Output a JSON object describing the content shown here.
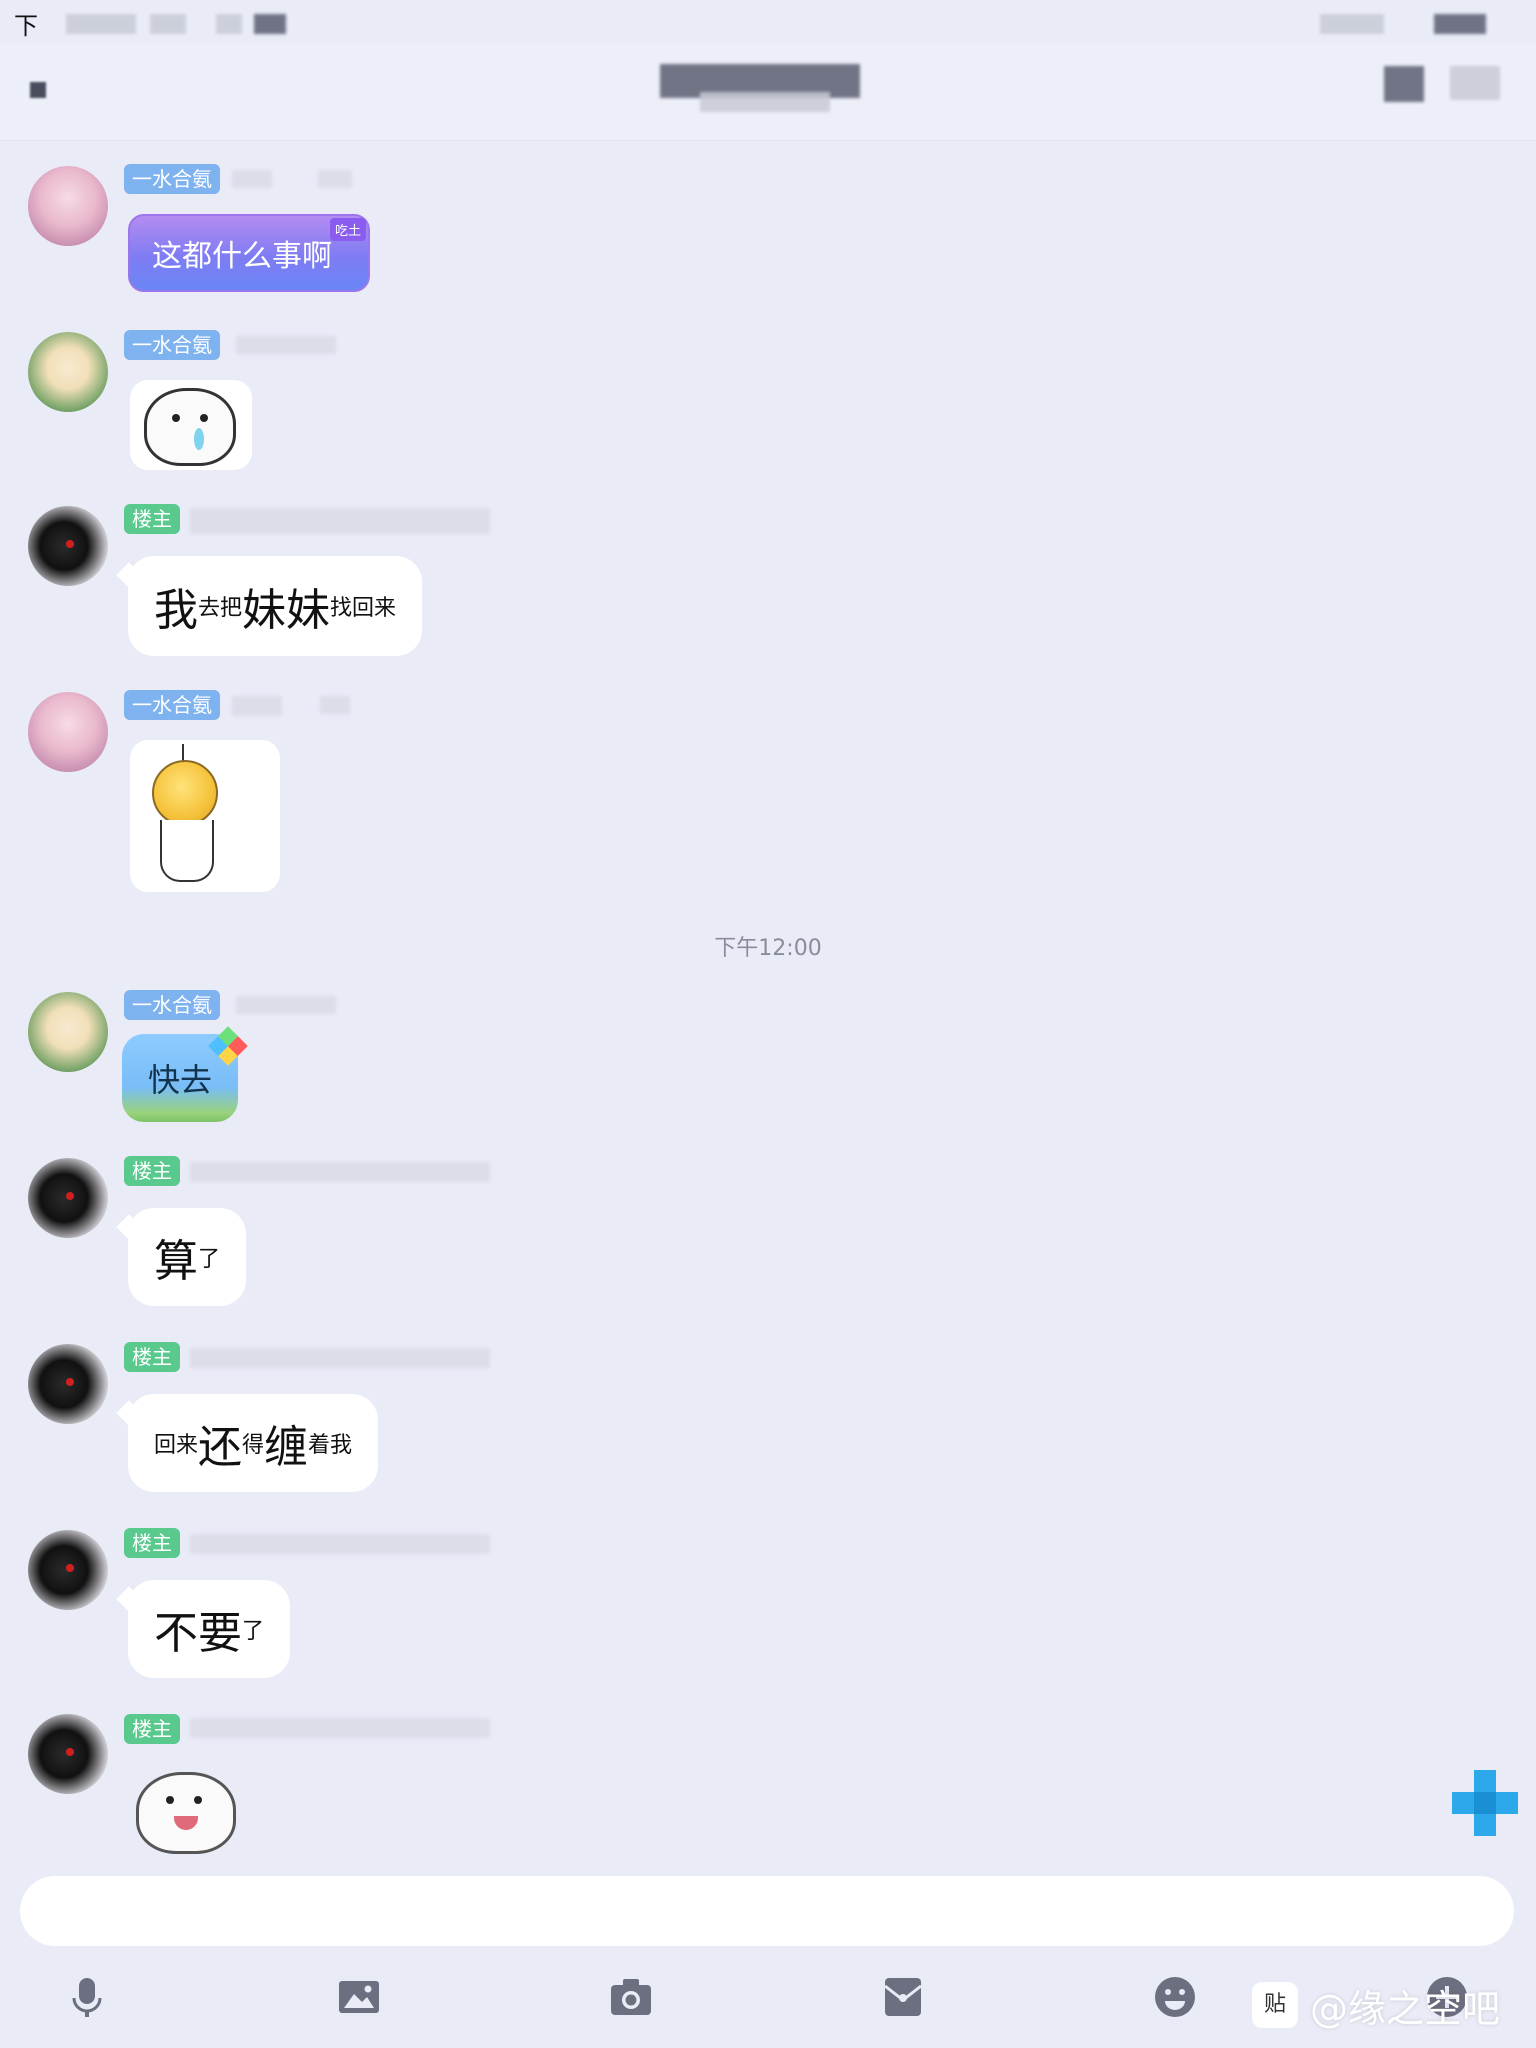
{
  "status_bar": {
    "time_partial": "下"
  },
  "messages": [
    {
      "tag": "一水合氨",
      "text": "这都什么事啊",
      "badge": "吃土"
    },
    {
      "tag": "一水合氨",
      "sticker": "crying-bear-sticker"
    },
    {
      "tag": "楼主",
      "parts": [
        "我",
        "去把",
        "妹妹",
        "找回来"
      ]
    },
    {
      "tag": "一水合氨",
      "sticker": "hanging-ball-sticker"
    },
    {
      "tag": "一水合氨",
      "text": "快去"
    },
    {
      "tag": "楼主",
      "parts": [
        "算",
        "了"
      ]
    },
    {
      "tag": "楼主",
      "parts": [
        "回来",
        "还",
        "得",
        "缠",
        "着",
        "我"
      ]
    },
    {
      "tag": "楼主",
      "parts": [
        "不要",
        "了"
      ]
    },
    {
      "tag": "楼主",
      "sticker": "laughing-bear-sticker"
    }
  ],
  "timestamp": "下午12:00",
  "toolbar": {
    "icons": [
      "microphone-icon",
      "image-icon",
      "camera-icon",
      "envelope-icon",
      "emoji-icon",
      "plus-icon"
    ]
  },
  "watermark": {
    "logo": "贴",
    "text": "@缘之空吧"
  }
}
